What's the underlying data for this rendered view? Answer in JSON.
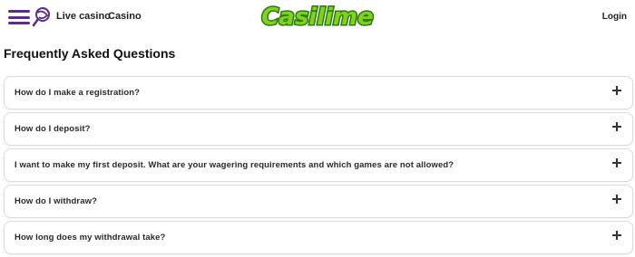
{
  "header": {
    "menu_icon": "hamburger-menu-icon",
    "lollipop_icon": "lollipop-icon",
    "nav": [
      {
        "label": "Live casino"
      },
      {
        "label": "Casino"
      }
    ],
    "logo_text": "Casilime",
    "login_label": "Login"
  },
  "faq": {
    "title": "Frequently Asked Questions",
    "items": [
      {
        "question": "How do I make a registration?",
        "icon": "plus-icon"
      },
      {
        "question": "How do I deposit?",
        "icon": "plus-icon"
      },
      {
        "question": "I want to make my first deposit. What are your wagering requirements and which games are not allowed?",
        "icon": "plus-icon"
      },
      {
        "question": "How do I withdraw?",
        "icon": "plus-icon"
      },
      {
        "question": "How long does my withdrawal take?",
        "icon": "plus-icon"
      }
    ]
  },
  "colors": {
    "brand_purple": "#5b2c8c",
    "logo_green": "#7ed321",
    "logo_dark_green": "#2f7a0e"
  }
}
